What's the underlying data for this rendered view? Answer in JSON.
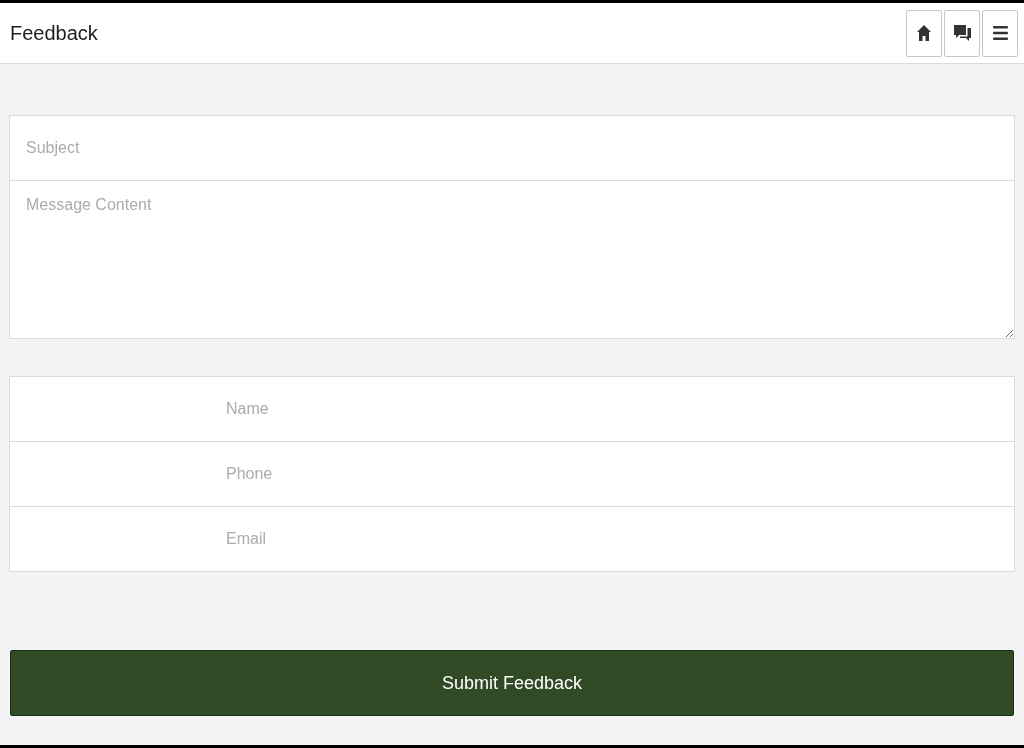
{
  "header": {
    "title": "Feedback"
  },
  "message_form": {
    "fields": [
      {
        "kind": "text",
        "placeholder": "Subject"
      },
      {
        "kind": "textarea",
        "placeholder": "Message Content"
      }
    ]
  },
  "contact_form": {
    "fields": [
      {
        "placeholder": "Name"
      },
      {
        "placeholder": "Phone"
      },
      {
        "placeholder": "Email"
      }
    ]
  },
  "submit_button": {
    "label": "Submit Feedback"
  }
}
